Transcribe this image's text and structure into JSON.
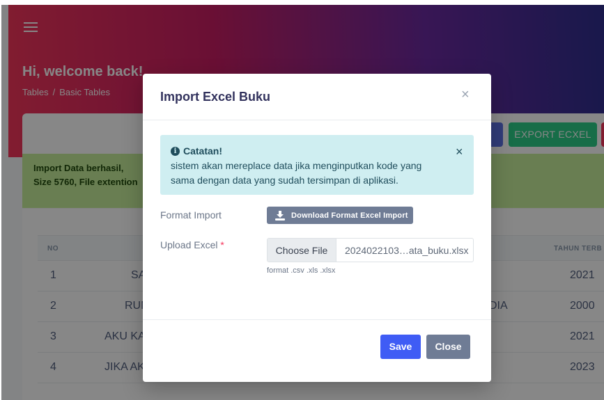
{
  "page": {
    "welcome": "Hi, welcome back!",
    "breadcrumb": [
      "Tables",
      "Basic Tables"
    ],
    "breadcrumb_separator": "/",
    "export_button": "EXPORT ECXEL",
    "alert": {
      "line1": "Import Data berhasil,",
      "line2": "Size 5760, File extention"
    },
    "table": {
      "headers": {
        "no": "NO",
        "year": "TAHUN TERB"
      },
      "rows": [
        {
          "no": "1",
          "title": "SA",
          "extra": "",
          "year": "2021"
        },
        {
          "no": "2",
          "title": "RUN",
          "extra": "DIA",
          "year": "2000"
        },
        {
          "no": "3",
          "title": "AKU KA",
          "extra": "",
          "year": "2021"
        },
        {
          "no": "4",
          "title": "JIKA AK",
          "extra": "",
          "year": "2023"
        }
      ]
    }
  },
  "modal": {
    "title": "Import Excel Buku",
    "close_glyph": "×",
    "note": {
      "icon_glyph": "i",
      "title": "Catatan!",
      "body": "sistem akan mereplace data jika menginputkan kode yang sama dengan data yang sudah tersimpan di aplikasi.",
      "close_glyph": "×"
    },
    "format_label": "Format Import",
    "download_button": "Download Format Excel Import",
    "upload_label": "Upload Excel",
    "required_mark": "*",
    "file_button": "Choose File",
    "file_name": "2024022103…ata_buku.xlsx",
    "file_hint": "format .csv .xls .xlsx",
    "save_button": "Save",
    "close_button": "Close"
  },
  "colors": {
    "primary": "#3f5cf5",
    "secondary": "#6f7c95",
    "info_bg": "#cfeef1",
    "success": "#2dce89",
    "danger": "#f5365c"
  },
  "icons": [
    "menu-icon",
    "info-icon",
    "download-icon",
    "close-icon"
  ]
}
